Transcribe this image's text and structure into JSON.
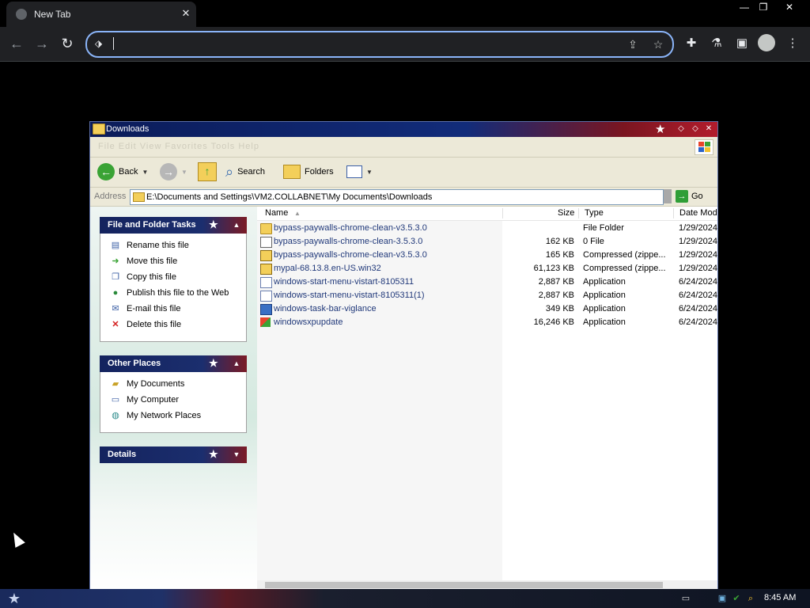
{
  "browser": {
    "tab_title": "New Tab",
    "tab_close": "✕",
    "omnibox_value": "",
    "window_controls": [
      "—",
      "❐",
      "✕"
    ]
  },
  "explorer": {
    "title": "Downloads",
    "menu_faint": "File  Edit  View  Favorites  Tools  Help",
    "toolbar": {
      "back_label": "Back",
      "search_label": "Search",
      "folders_label": "Folders"
    },
    "address": {
      "label": "Address",
      "value": "E:\\Documents and Settings\\VM2.COLLABNET\\My Documents\\Downloads",
      "go_label": "Go"
    },
    "file_folder_tasks": {
      "title": "File and Folder Tasks",
      "items": [
        {
          "label": "Rename this file",
          "icon": "rename-icon"
        },
        {
          "label": "Move this file",
          "icon": "move-icon"
        },
        {
          "label": "Copy this file",
          "icon": "copy-icon"
        },
        {
          "label": "Publish this file to the Web",
          "icon": "globe-icon"
        },
        {
          "label": "E-mail this file",
          "icon": "email-icon"
        },
        {
          "label": "Delete this file",
          "icon": "delete-icon"
        }
      ]
    },
    "other_places": {
      "title": "Other Places",
      "items": [
        {
          "label": "My Documents",
          "icon": "my-documents-icon"
        },
        {
          "label": "My Computer",
          "icon": "my-computer-icon"
        },
        {
          "label": "My Network Places",
          "icon": "network-icon"
        }
      ]
    },
    "details": {
      "title": "Details"
    },
    "columns": [
      "Name",
      "Size",
      "Type",
      "Date Mod"
    ],
    "files": [
      {
        "name": "bypass-paywalls-chrome-clean-v3.5.3.0",
        "size": "",
        "type": "File Folder",
        "date": "1/29/2024",
        "icon": "folder-icon"
      },
      {
        "name": "bypass-paywalls-chrome-clean-3.5.3.0",
        "size": "162 KB",
        "type": "0 File",
        "date": "1/29/2024",
        "icon": "file-icon"
      },
      {
        "name": "bypass-paywalls-chrome-clean-v3.5.3.0",
        "size": "165 KB",
        "type": "Compressed (zippe...",
        "date": "1/29/2024",
        "icon": "zip-icon"
      },
      {
        "name": "mypal-68.13.8.en-US.win32",
        "size": "61,123 KB",
        "type": "Compressed (zippe...",
        "date": "1/29/2024",
        "icon": "zip-icon"
      },
      {
        "name": "windows-start-menu-vistart-8105311",
        "size": "2,887 KB",
        "type": "Application",
        "date": "6/24/2024",
        "icon": "setup-icon"
      },
      {
        "name": "windows-start-menu-vistart-8105311(1)",
        "size": "2,887 KB",
        "type": "Application",
        "date": "6/24/2024",
        "icon": "setup-icon"
      },
      {
        "name": "windows-task-bar-viglance",
        "size": "349 KB",
        "type": "Application",
        "date": "6/24/2024",
        "icon": "app-icon"
      },
      {
        "name": "windowsxpupdate",
        "size": "16,246 KB",
        "type": "Application",
        "date": "6/24/2024",
        "icon": "xp-update-icon"
      }
    ]
  },
  "taskbar": {
    "clock": "8:45 AM"
  }
}
